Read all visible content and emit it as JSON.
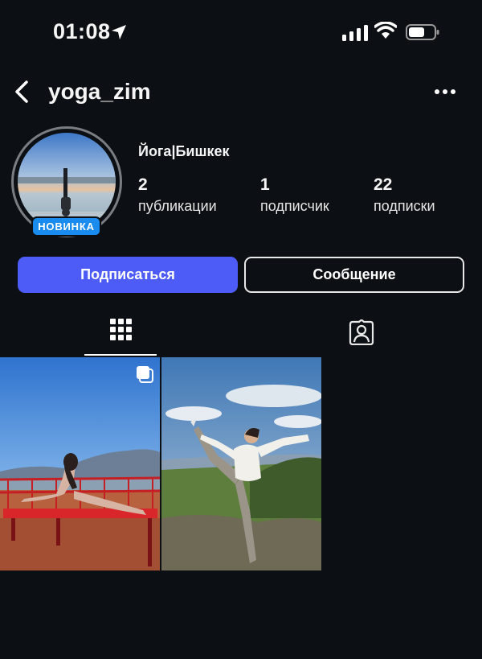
{
  "status_bar": {
    "time": "01:08",
    "icons": [
      "location-arrow-icon",
      "cellular-signal-icon",
      "wifi-icon",
      "battery-icon"
    ]
  },
  "header": {
    "username": "yoga_zim",
    "icons": [
      "back-chevron-icon",
      "more-dots-icon"
    ]
  },
  "profile": {
    "badge": "НОВИНКА",
    "display_name": "Йога|Бишкек",
    "stats": [
      {
        "value": "2",
        "label": "публикации"
      },
      {
        "value": "1",
        "label": "подписчик"
      },
      {
        "value": "22",
        "label": "подписки"
      }
    ]
  },
  "actions": {
    "follow_label": "Подписаться",
    "message_label": "Сообщение"
  },
  "tabs": {
    "grid_icon": "grid-icon",
    "tagged_icon": "tagged-person-icon",
    "active": "grid"
  },
  "posts": [
    {
      "multi_image": true,
      "icon": "carousel-icon"
    },
    {
      "multi_image": false
    }
  ],
  "colors": {
    "background": "#0c0f13",
    "follow_button": "#4d5cf6",
    "badge": "#1a8cf0"
  }
}
